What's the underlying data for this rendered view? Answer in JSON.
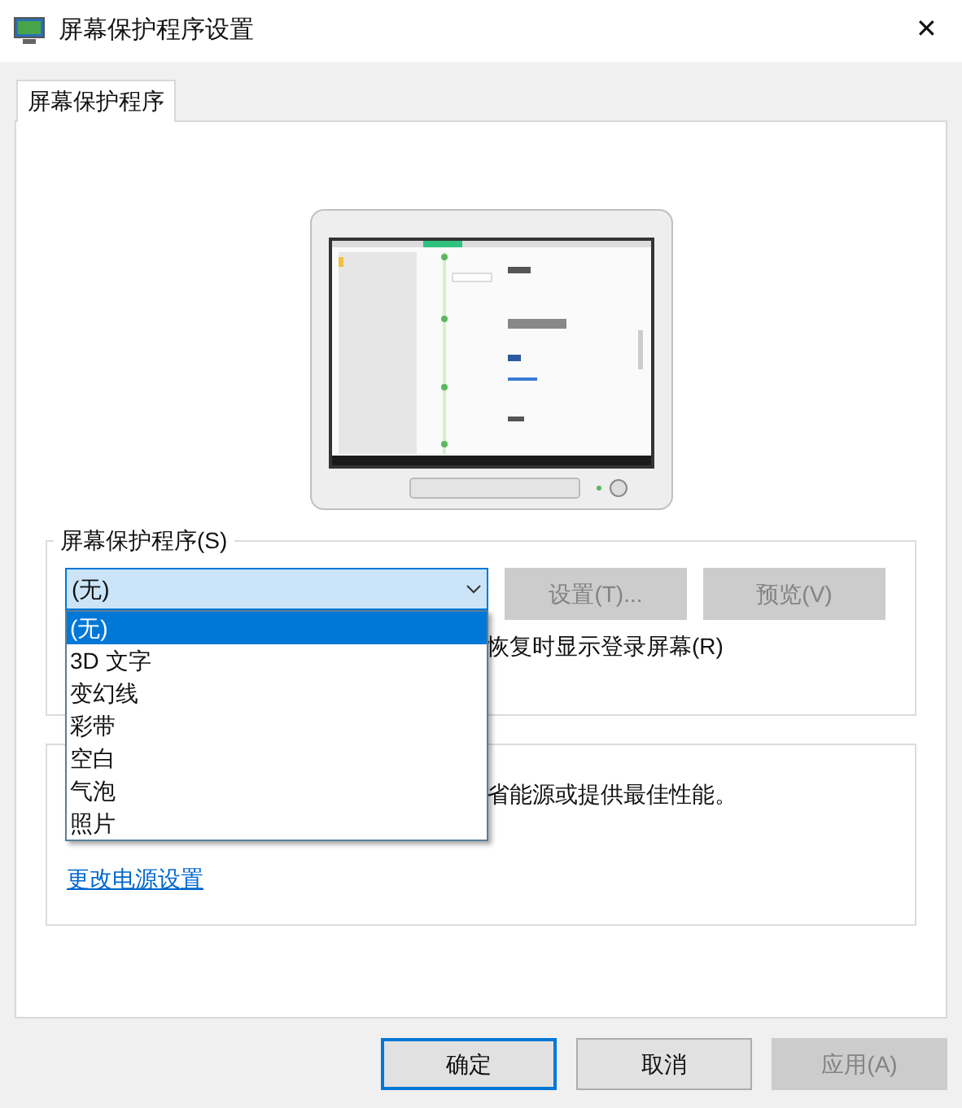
{
  "window": {
    "title": "屏幕保护程序设置",
    "close": "✕"
  },
  "tabs": [
    {
      "label": "屏幕保护程序",
      "selected": true
    }
  ],
  "screensaver_group": {
    "legend": "屏幕保护程序(S)",
    "combo_value": "(无)",
    "options": [
      {
        "label": "(无)",
        "selected": true
      },
      {
        "label": "3D 文字",
        "selected": false
      },
      {
        "label": "变幻线",
        "selected": false
      },
      {
        "label": "彩带",
        "selected": false
      },
      {
        "label": "空白",
        "selected": false
      },
      {
        "label": "气泡",
        "selected": false
      },
      {
        "label": "照片",
        "selected": false
      }
    ],
    "buttons": [
      {
        "label": "设置(T)...",
        "disabled": true
      },
      {
        "label": "预览(V)",
        "disabled": true
      }
    ],
    "logon_text": "恢复时显示登录屏幕(R)"
  },
  "power_group": {
    "text": "省能源或提供最佳性能。",
    "link": "更改电源设置"
  },
  "footer_buttons": [
    {
      "label": "确定",
      "default": true,
      "disabled": false
    },
    {
      "label": "取消",
      "default": false,
      "disabled": false
    },
    {
      "label": "应用(A)",
      "default": false,
      "disabled": true
    }
  ]
}
